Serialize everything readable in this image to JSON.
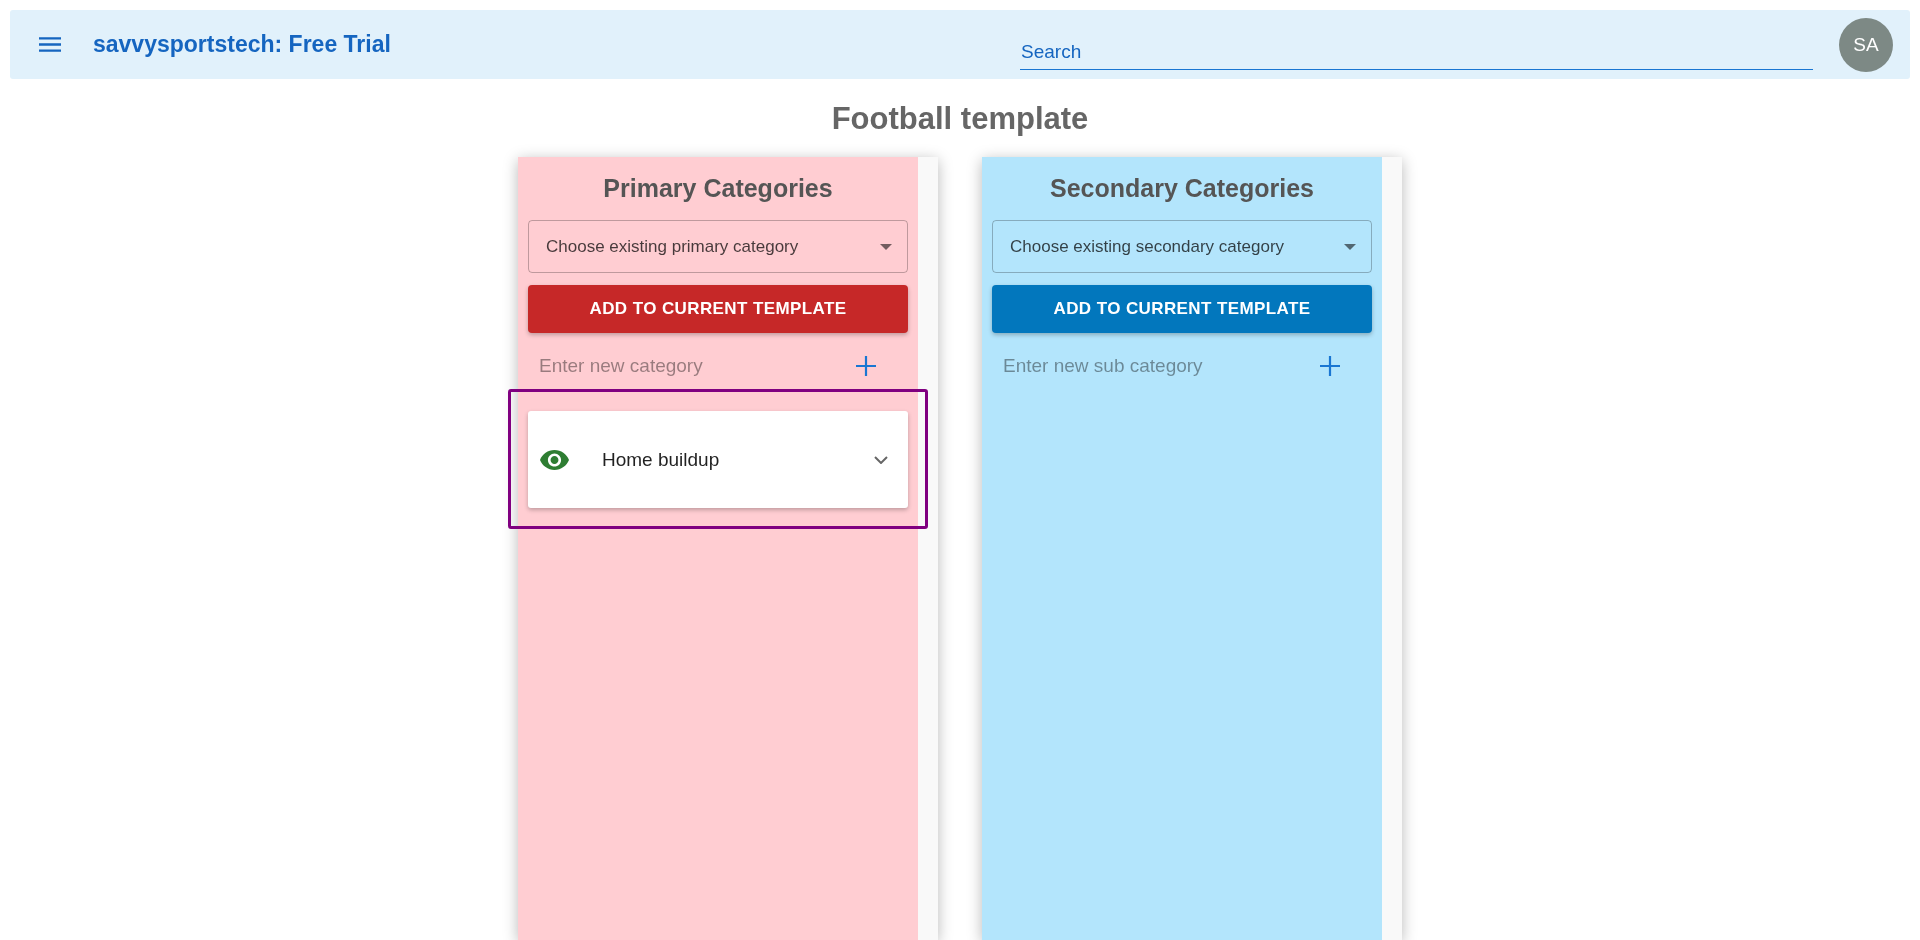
{
  "app_bar": {
    "title": "savvysportstech: Free Trial",
    "search": {
      "placeholder": "Search"
    },
    "avatar": {
      "initials": "SA"
    }
  },
  "page": {
    "title": "Football template"
  },
  "columns": [
    {
      "kind": "primary",
      "title": "Primary Categories",
      "dropdown": {
        "placeholder": "Choose existing primary category"
      },
      "add_button": "ADD TO CURRENT TEMPLATE",
      "new_entry": {
        "placeholder": "Enter new category"
      },
      "items": [
        {
          "label": "Home buildup",
          "visible": true,
          "expanded": false
        }
      ]
    },
    {
      "kind": "secondary",
      "title": "Secondary Categories",
      "dropdown": {
        "placeholder": "Choose existing secondary category"
      },
      "add_button": "ADD TO CURRENT TEMPLATE",
      "new_entry": {
        "placeholder": "Enter new sub category"
      }
    }
  ]
}
